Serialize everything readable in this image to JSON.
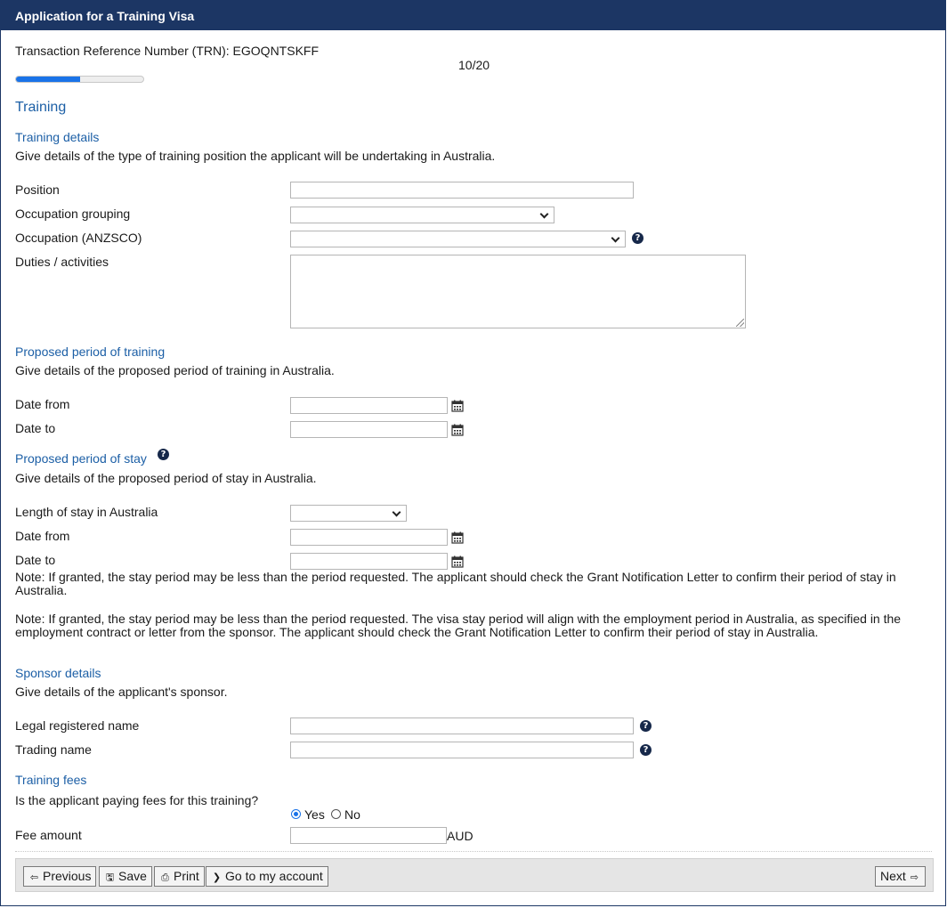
{
  "window": {
    "title": "Application for a Training Visa"
  },
  "header": {
    "trn": "Transaction Reference Number (TRN): EGOQNTSKFF",
    "page_counter": "10/20",
    "progress": 0.5
  },
  "page_title": "Training",
  "training_details": {
    "heading": "Training details",
    "description": "Give details of the type of training position the applicant will be undertaking in Australia.",
    "position_label": "Position",
    "position_value": "",
    "occupation_grouping_label": "Occupation grouping",
    "occupation_grouping_value": "",
    "occupation_anzsco_label": "Occupation (ANZSCO)",
    "occupation_anzsco_value": "",
    "duties_label": "Duties / activities",
    "duties_value": ""
  },
  "proposed_training": {
    "heading": "Proposed period of training",
    "description": "Give details of the proposed period of training in Australia.",
    "date_from_label": "Date from",
    "date_to_label": "Date to"
  },
  "proposed_stay": {
    "heading": "Proposed period of stay",
    "description": "Give details of the proposed period of stay in Australia.",
    "length_label": "Length of stay in Australia",
    "length_value": "",
    "date_from_label": "Date from",
    "date_to_label": "Date to",
    "note1": "Note: If granted, the stay period may be less than the period requested. The applicant should check the Grant Notification Letter to confirm their period of stay in Australia.",
    "note2": "Note: If granted, the stay period may be less than the period requested. The visa stay period will align with the employment period in Australia, as specified in the employment contract or letter from the sponsor. The applicant should check the Grant Notification Letter to confirm their period of stay in Australia."
  },
  "sponsor": {
    "heading": "Sponsor details",
    "description": "Give details of the applicant's sponsor.",
    "legal_name_label": "Legal registered name",
    "trading_name_label": "Trading name"
  },
  "fees": {
    "heading": "Training fees",
    "question": "Is the applicant paying fees for this training?",
    "yes_label": "Yes",
    "no_label": "No",
    "selected": "Yes",
    "fee_amount_label": "Fee amount",
    "currency": "AUD"
  },
  "footer": {
    "previous_label": "Previous",
    "save_label": "Save",
    "print_label": "Print",
    "account_label": "Go to my account",
    "next_label": "Next"
  },
  "icons": {
    "help": "question-circle-icon",
    "calendar": "calendar-icon",
    "previous": "arrow-left-icon",
    "save": "floppy-disk-icon",
    "print": "printer-icon",
    "account": "chevron-right-icon",
    "next": "arrow-right-icon"
  },
  "colors": {
    "brand": "#1c3664",
    "link": "#1c5fa6",
    "progress": "#1a73e8"
  }
}
